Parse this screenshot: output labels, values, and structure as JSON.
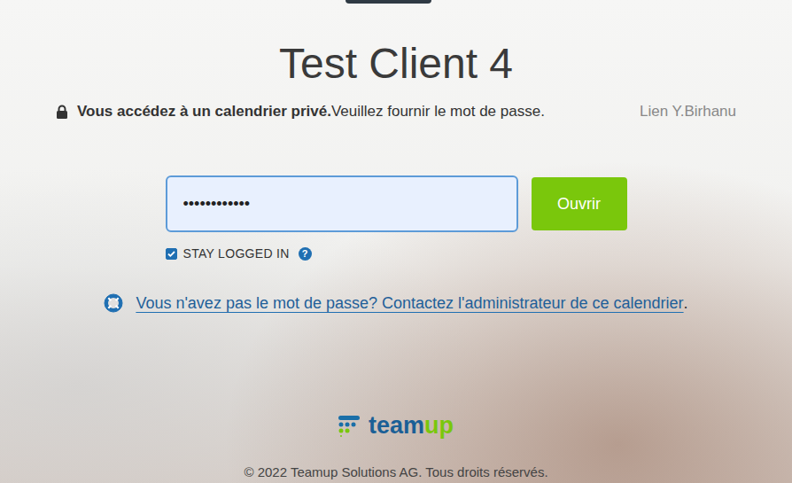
{
  "page": {
    "title": "Test Client 4"
  },
  "notice": {
    "bold": "Vous accédez à un calendrier privé.",
    "text": "Veuillez fournir le mot de passe.",
    "user": "Lien Y.Birhanu"
  },
  "password_field": {
    "value": "••••••••••••",
    "focused": true
  },
  "open_button": {
    "label": "Ouvrir"
  },
  "stay_logged_in": {
    "label": "STAY LOGGED IN",
    "checked": true,
    "help": "?"
  },
  "help_link": {
    "text": "Vous n'avez pas le mot de passe? Contactez l'administrateur de ce calendrier",
    "suffix": "."
  },
  "logo": {
    "part1": "team",
    "part2": "up"
  },
  "footer": "© 2022 Teamup Solutions AG. Tous droits réservés."
}
